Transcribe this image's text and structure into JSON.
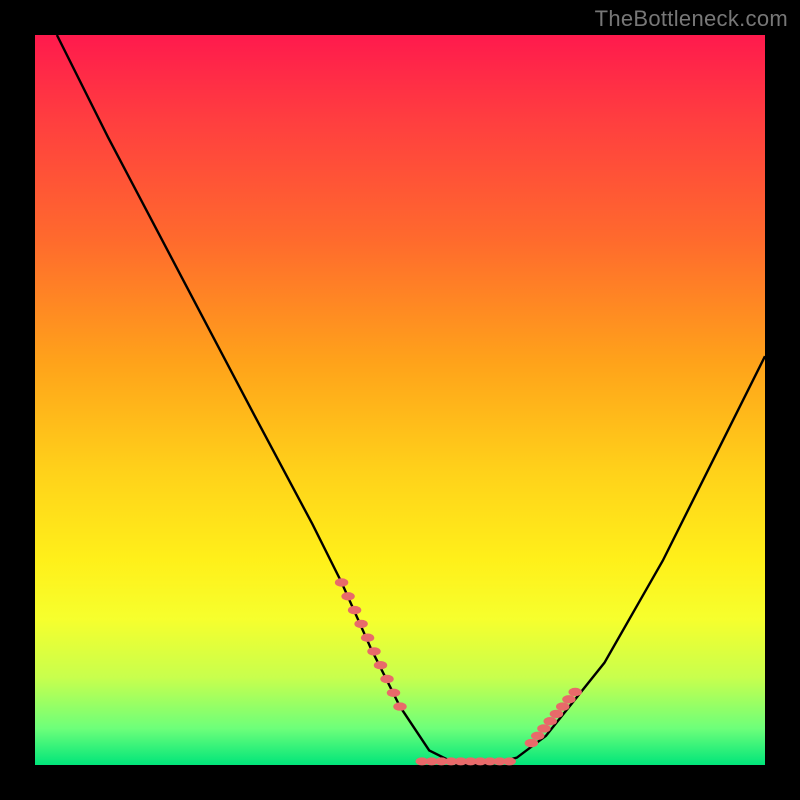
{
  "watermark": "TheBottleneck.com",
  "colors": {
    "background": "#000000",
    "gradient_top": "#ff1a4d",
    "gradient_bottom": "#00e57a",
    "curve": "#000000",
    "marker": "#e86a6a"
  },
  "chart_data": {
    "type": "line",
    "title": "",
    "xlabel": "",
    "ylabel": "",
    "xlim": [
      0,
      100
    ],
    "ylim": [
      0,
      100
    ],
    "grid": false,
    "legend": false,
    "series": [
      {
        "name": "curve",
        "x": [
          3,
          10,
          20,
          30,
          38,
          42,
          46,
          50,
          54,
          58,
          62,
          66,
          70,
          78,
          86,
          94,
          100
        ],
        "y": [
          100,
          86,
          67,
          48,
          33,
          25,
          16,
          8,
          2,
          0,
          0,
          1,
          4,
          14,
          28,
          44,
          56
        ]
      }
    ],
    "markers": {
      "note": "dotted salmon highlight segments on the curve near the valley",
      "left_segment": {
        "x": [
          42,
          50
        ],
        "y": [
          25,
          8
        ]
      },
      "right_segment": {
        "x": [
          68,
          74
        ],
        "y": [
          3,
          10
        ]
      },
      "valley_segment": {
        "x": [
          53,
          65
        ],
        "y": [
          0.5,
          0.5
        ]
      }
    }
  }
}
